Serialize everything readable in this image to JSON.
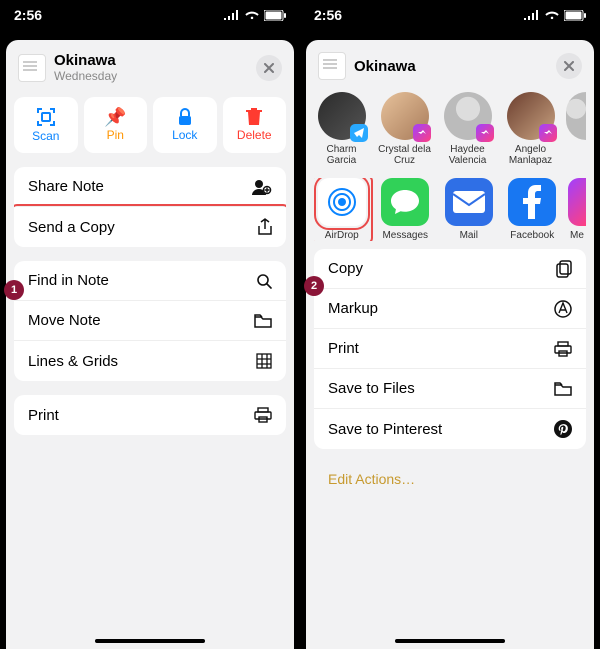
{
  "status": {
    "time": "2:56"
  },
  "left": {
    "title": "Okinawa",
    "subtitle": "Wednesday",
    "quick": {
      "scan": "Scan",
      "pin": "Pin",
      "lock": "Lock",
      "delete": "Delete"
    },
    "menu1": {
      "share": "Share Note",
      "send_copy": "Send a Copy"
    },
    "menu2": {
      "find": "Find in Note",
      "move": "Move Note",
      "lines": "Lines & Grids"
    },
    "menu3": {
      "print": "Print"
    },
    "badge": "1"
  },
  "right": {
    "title": "Okinawa",
    "contacts": [
      {
        "name": "Charm Garcia"
      },
      {
        "name": "Crystal dela Cruz"
      },
      {
        "name": "Haydee Valencia"
      },
      {
        "name": "Angelo Manlapaz"
      }
    ],
    "apps": {
      "airdrop": "AirDrop",
      "messages": "Messages",
      "mail": "Mail",
      "facebook": "Facebook",
      "mes_cut": "Me"
    },
    "actions": {
      "copy": "Copy",
      "markup": "Markup",
      "print": "Print",
      "save_files": "Save to Files",
      "save_pinterest": "Save to Pinterest"
    },
    "edit": "Edit Actions…",
    "badge": "2"
  }
}
